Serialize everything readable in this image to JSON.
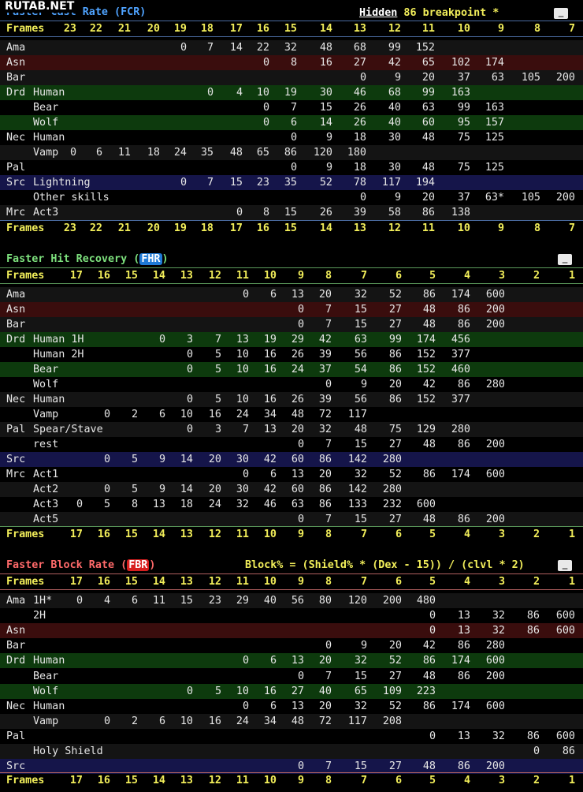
{
  "watermark": "RUTAB.NET",
  "colors": {
    "amber": "#1a1a1a",
    "frames": "#f2ee5a",
    "fcr": "#4fa3ff",
    "fhr": "#7de07d",
    "fbr": "#ff6a6a"
  },
  "fcr": {
    "title_a": "Faster Cast ",
    "title_b": "Rate (FCR)",
    "hidden_label": "Hidden",
    "hidden_text": " 86 breakpoint *",
    "box": "_",
    "frames_label": "Frames",
    "frames": [
      "23",
      "22",
      "21",
      "20",
      "19",
      "18",
      "17",
      "16",
      "15",
      "14",
      "13",
      "12",
      "11",
      "10",
      "9",
      "8",
      "7"
    ],
    "rows": [
      {
        "cls": "Ama",
        "sub": "",
        "bg": "#141414",
        "v": [
          "",
          "",
          "",
          "",
          "0",
          "7",
          "14",
          "22",
          "32",
          "48",
          "68",
          "99",
          "152",
          "",
          "",
          "",
          ""
        ]
      },
      {
        "cls": "Asn",
        "sub": "",
        "bg": "#3a0d0d",
        "v": [
          "",
          "",
          "",
          "",
          "",
          "",
          "",
          "0",
          "8",
          "16",
          "27",
          "42",
          "65",
          "102",
          "174",
          "",
          ""
        ]
      },
      {
        "cls": "Bar",
        "sub": "",
        "bg": "#141414",
        "v": [
          "",
          "",
          "",
          "",
          "",
          "",
          "",
          "",
          "",
          "",
          "0",
          "9",
          "20",
          "37",
          "63",
          "105",
          "200"
        ]
      },
      {
        "cls": "Drd",
        "sub": "Human",
        "bg": "#0d3a0d",
        "v": [
          "",
          "",
          "",
          "",
          "",
          "0",
          "4",
          "10",
          "19",
          "30",
          "46",
          "68",
          "99",
          "163",
          "",
          "",
          ""
        ]
      },
      {
        "cls": "",
        "sub": "Bear",
        "bg": "#000",
        "v": [
          "",
          "",
          "",
          "",
          "",
          "",
          "",
          "0",
          "7",
          "15",
          "26",
          "40",
          "63",
          "99",
          "163",
          "",
          ""
        ]
      },
      {
        "cls": "",
        "sub": "Wolf",
        "bg": "#0d3a0d",
        "v": [
          "",
          "",
          "",
          "",
          "",
          "",
          "",
          "0",
          "6",
          "14",
          "26",
          "40",
          "60",
          "95",
          "157",
          "",
          ""
        ]
      },
      {
        "cls": "Nec",
        "sub": "Human",
        "bg": "#000",
        "v": [
          "",
          "",
          "",
          "",
          "",
          "",
          "",
          "",
          "0",
          "9",
          "18",
          "30",
          "48",
          "75",
          "125",
          "",
          ""
        ]
      },
      {
        "cls": "",
        "sub": "Vamp",
        "bg": "#141414",
        "v": [
          "0",
          "6",
          "11",
          "18",
          "24",
          "35",
          "48",
          "65",
          "86",
          "120",
          "180",
          "",
          "",
          "",
          "",
          "",
          ""
        ]
      },
      {
        "cls": "Pal",
        "sub": "",
        "bg": "#000",
        "v": [
          "",
          "",
          "",
          "",
          "",
          "",
          "",
          "",
          "0",
          "9",
          "18",
          "30",
          "48",
          "75",
          "125",
          "",
          ""
        ]
      },
      {
        "cls": "Src",
        "sub": "Lightning",
        "bg": "#15154a",
        "v": [
          "",
          "",
          "",
          "",
          "0",
          "7",
          "15",
          "23",
          "35",
          "52",
          "78",
          "117",
          "194",
          "",
          "",
          "",
          ""
        ]
      },
      {
        "cls": "",
        "sub": "Other skills",
        "bg": "#000",
        "v": [
          "",
          "",
          "",
          "",
          "",
          "",
          "",
          "",
          "",
          "",
          "0",
          "9",
          "20",
          "37",
          "63*",
          "105",
          "200"
        ]
      },
      {
        "cls": "Mrc",
        "sub": "Act3",
        "bg": "#141414",
        "v": [
          "",
          "",
          "",
          "",
          "",
          "",
          "0",
          "8",
          "15",
          "26",
          "39",
          "58",
          "86",
          "138",
          "",
          "",
          ""
        ]
      }
    ]
  },
  "fhr": {
    "title_a": "Faster Hit Recovery (",
    "title_badge": "FHR",
    "title_c": ")",
    "box": "_",
    "frames_label": "Frames",
    "frames": [
      "17",
      "16",
      "15",
      "14",
      "13",
      "12",
      "11",
      "10",
      "9",
      "8",
      "7",
      "6",
      "5",
      "4",
      "3",
      "2",
      "1"
    ],
    "rows": [
      {
        "cls": "Ama",
        "sub": "",
        "bg": "#141414",
        "v": [
          "",
          "",
          "",
          "",
          "",
          "",
          "0",
          "6",
          "13",
          "20",
          "32",
          "52",
          "86",
          "174",
          "600",
          "",
          ""
        ]
      },
      {
        "cls": "Asn",
        "sub": "",
        "bg": "#3a0d0d",
        "v": [
          "",
          "",
          "",
          "",
          "",
          "",
          "",
          "",
          "0",
          "7",
          "15",
          "27",
          "48",
          "86",
          "200",
          "",
          ""
        ]
      },
      {
        "cls": "Bar",
        "sub": "",
        "bg": "#141414",
        "v": [
          "",
          "",
          "",
          "",
          "",
          "",
          "",
          "",
          "0",
          "7",
          "15",
          "27",
          "48",
          "86",
          "200",
          "",
          ""
        ]
      },
      {
        "cls": "Drd",
        "sub": "Human 1H",
        "bg": "#0d3a0d",
        "v": [
          "",
          "",
          "",
          "0",
          "3",
          "7",
          "13",
          "19",
          "29",
          "42",
          "63",
          "99",
          "174",
          "456",
          "",
          "",
          ""
        ]
      },
      {
        "cls": "",
        "sub": "Human 2H",
        "bg": "#000",
        "v": [
          "",
          "",
          "",
          "",
          "0",
          "5",
          "10",
          "16",
          "26",
          "39",
          "56",
          "86",
          "152",
          "377",
          "",
          "",
          ""
        ]
      },
      {
        "cls": "",
        "sub": "Bear",
        "bg": "#0d3a0d",
        "v": [
          "",
          "",
          "",
          "",
          "0",
          "5",
          "10",
          "16",
          "24",
          "37",
          "54",
          "86",
          "152",
          "460",
          "",
          "",
          ""
        ]
      },
      {
        "cls": "",
        "sub": "Wolf",
        "bg": "#000",
        "v": [
          "",
          "",
          "",
          "",
          "",
          "",
          "",
          "",
          "",
          "0",
          "9",
          "20",
          "42",
          "86",
          "280",
          "",
          ""
        ]
      },
      {
        "cls": "Nec",
        "sub": "Human",
        "bg": "#141414",
        "v": [
          "",
          "",
          "",
          "",
          "0",
          "5",
          "10",
          "16",
          "26",
          "39",
          "56",
          "86",
          "152",
          "377",
          "",
          "",
          ""
        ]
      },
      {
        "cls": "",
        "sub": "Vamp",
        "bg": "#000",
        "v": [
          "",
          "0",
          "2",
          "6",
          "10",
          "16",
          "24",
          "34",
          "48",
          "72",
          "117",
          "",
          "",
          "",
          "",
          "",
          ""
        ]
      },
      {
        "cls": "Pal",
        "sub": "Spear/Stave",
        "bg": "#141414",
        "v": [
          "",
          "",
          "",
          "",
          "0",
          "3",
          "7",
          "13",
          "20",
          "32",
          "48",
          "75",
          "129",
          "280",
          "",
          "",
          ""
        ]
      },
      {
        "cls": "",
        "sub": "rest",
        "bg": "#000",
        "v": [
          "",
          "",
          "",
          "",
          "",
          "",
          "",
          "",
          "0",
          "7",
          "15",
          "27",
          "48",
          "86",
          "200",
          "",
          ""
        ]
      },
      {
        "cls": "Src",
        "sub": "",
        "bg": "#15154a",
        "v": [
          "",
          "0",
          "5",
          "9",
          "14",
          "20",
          "30",
          "42",
          "60",
          "86",
          "142",
          "280",
          "",
          "",
          "",
          "",
          ""
        ]
      },
      {
        "cls": "Mrc",
        "sub": "Act1",
        "bg": "#000",
        "v": [
          "",
          "",
          "",
          "",
          "",
          "",
          "0",
          "6",
          "13",
          "20",
          "32",
          "52",
          "86",
          "174",
          "600",
          "",
          ""
        ]
      },
      {
        "cls": "",
        "sub": "Act2",
        "bg": "#141414",
        "v": [
          "",
          "0",
          "5",
          "9",
          "14",
          "20",
          "30",
          "42",
          "60",
          "86",
          "142",
          "280",
          "",
          "",
          "",
          "",
          ""
        ]
      },
      {
        "cls": "",
        "sub": "Act3",
        "bg": "#000",
        "v": [
          "0",
          "5",
          "8",
          "13",
          "18",
          "24",
          "32",
          "46",
          "63",
          "86",
          "133",
          "232",
          "600",
          "",
          "",
          "",
          ""
        ]
      },
      {
        "cls": "",
        "sub": "Act5",
        "bg": "#141414",
        "v": [
          "",
          "",
          "",
          "",
          "",
          "",
          "",
          "",
          "0",
          "7",
          "15",
          "27",
          "48",
          "86",
          "200",
          "",
          ""
        ]
      }
    ]
  },
  "fbr": {
    "title_a": "Faster Block Rate (",
    "title_badge": "FBR",
    "title_c": ")",
    "formula": "Block% = (Shield% * (Dex - 15)) / (clvl * 2)",
    "box": "_",
    "frames_label": "Frames",
    "frames": [
      "17",
      "16",
      "15",
      "14",
      "13",
      "12",
      "11",
      "10",
      "9",
      "8",
      "7",
      "6",
      "5",
      "4",
      "3",
      "2",
      "1"
    ],
    "rows": [
      {
        "cls": "Ama",
        "sub": "1H*",
        "bg": "#141414",
        "v": [
          "0",
          "4",
          "6",
          "11",
          "15",
          "23",
          "29",
          "40",
          "56",
          "80",
          "120",
          "200",
          "480",
          "",
          "",
          "",
          ""
        ]
      },
      {
        "cls": "",
        "sub": "2H",
        "bg": "#000",
        "v": [
          "",
          "",
          "",
          "",
          "",
          "",
          "",
          "",
          "",
          "",
          "",
          "",
          "0",
          "13",
          "32",
          "86",
          "600"
        ]
      },
      {
        "cls": "Asn",
        "sub": "",
        "bg": "#3a0d0d",
        "v": [
          "",
          "",
          "",
          "",
          "",
          "",
          "",
          "",
          "",
          "",
          "",
          "",
          "0",
          "13",
          "32",
          "86",
          "600"
        ]
      },
      {
        "cls": "Bar",
        "sub": "",
        "bg": "#000",
        "v": [
          "",
          "",
          "",
          "",
          "",
          "",
          "",
          "",
          "",
          "0",
          "9",
          "20",
          "42",
          "86",
          "280",
          "",
          ""
        ]
      },
      {
        "cls": "Drd",
        "sub": "Human",
        "bg": "#0d3a0d",
        "v": [
          "",
          "",
          "",
          "",
          "",
          "",
          "0",
          "6",
          "13",
          "20",
          "32",
          "52",
          "86",
          "174",
          "600",
          "",
          ""
        ]
      },
      {
        "cls": "",
        "sub": "Bear",
        "bg": "#000",
        "v": [
          "",
          "",
          "",
          "",
          "",
          "",
          "",
          "",
          "0",
          "7",
          "15",
          "27",
          "48",
          "86",
          "200",
          "",
          ""
        ]
      },
      {
        "cls": "",
        "sub": "Wolf",
        "bg": "#0d3a0d",
        "v": [
          "",
          "",
          "",
          "",
          "0",
          "5",
          "10",
          "16",
          "27",
          "40",
          "65",
          "109",
          "223",
          "",
          "",
          "",
          ""
        ]
      },
      {
        "cls": "Nec",
        "sub": "Human",
        "bg": "#000",
        "v": [
          "",
          "",
          "",
          "",
          "",
          "",
          "0",
          "6",
          "13",
          "20",
          "32",
          "52",
          "86",
          "174",
          "600",
          "",
          ""
        ]
      },
      {
        "cls": "",
        "sub": "Vamp",
        "bg": "#141414",
        "v": [
          "",
          "0",
          "2",
          "6",
          "10",
          "16",
          "24",
          "34",
          "48",
          "72",
          "117",
          "208",
          "",
          "",
          "",
          "",
          ""
        ]
      },
      {
        "cls": "Pal",
        "sub": "",
        "bg": "#000",
        "v": [
          "",
          "",
          "",
          "",
          "",
          "",
          "",
          "",
          "",
          "",
          "",
          "",
          "0",
          "13",
          "32",
          "86",
          "600"
        ]
      },
      {
        "cls": "",
        "sub": "Holy Shield",
        "bg": "#141414",
        "v": [
          "",
          "",
          "",
          "",
          "",
          "",
          "",
          "",
          "",
          "",
          "",
          "",
          "",
          "",
          "",
          "0",
          "86"
        ]
      },
      {
        "cls": "Src",
        "sub": "",
        "bg": "#15154a",
        "v": [
          "",
          "",
          "",
          "",
          "",
          "",
          "",
          "",
          "0",
          "7",
          "15",
          "27",
          "48",
          "86",
          "200",
          "",
          ""
        ]
      }
    ]
  }
}
